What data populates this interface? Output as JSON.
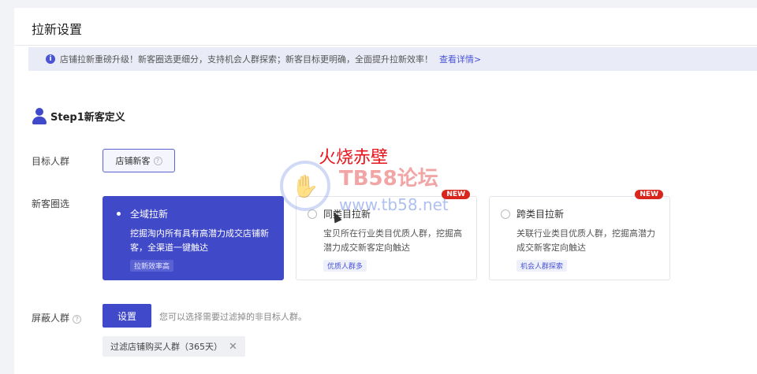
{
  "panel": {
    "title": "拉新设置"
  },
  "notice": {
    "icon": "info-icon",
    "text": "店铺拉新重磅升级！新客圈选更细分，支持机会人群探索；新客目标更明确，全面提升拉新效率！",
    "link": "查看详情>"
  },
  "step": {
    "label": "Step1新客定义",
    "icon": "user-icon"
  },
  "target": {
    "label": "目标人群",
    "option": "店铺新客"
  },
  "circle": {
    "label": "新客圈选",
    "cards": [
      {
        "title": "全域拉新",
        "desc": "挖掘淘内所有具有高潜力成交店铺新客，全渠道一键触达",
        "tag": "拉新效率高",
        "badge": ""
      },
      {
        "title": "同类目拉新",
        "desc": "宝贝所在行业类目优质人群，挖掘高潜力成交新客定向触达",
        "tag": "优质人群多",
        "badge": "NEW"
      },
      {
        "title": "跨类目拉新",
        "desc": "关联行业类目优质人群，挖掘高潜力成交新客定向触达",
        "tag": "机会人群探索",
        "badge": "NEW"
      }
    ]
  },
  "exclude": {
    "label": "屏蔽人群",
    "button": "设置",
    "hint": "您可以选择需要过滤掉的非目标人群。",
    "chip": "过滤店铺购买人群（365天）"
  },
  "watermark": {
    "overlay": "火烧赤壁",
    "brand": "TB58论坛",
    "url": "www.tb58.net"
  },
  "colors": {
    "accent": "#3f49c9",
    "new_badge": "#d8261d",
    "notice_bg": "#e9ecf7"
  }
}
